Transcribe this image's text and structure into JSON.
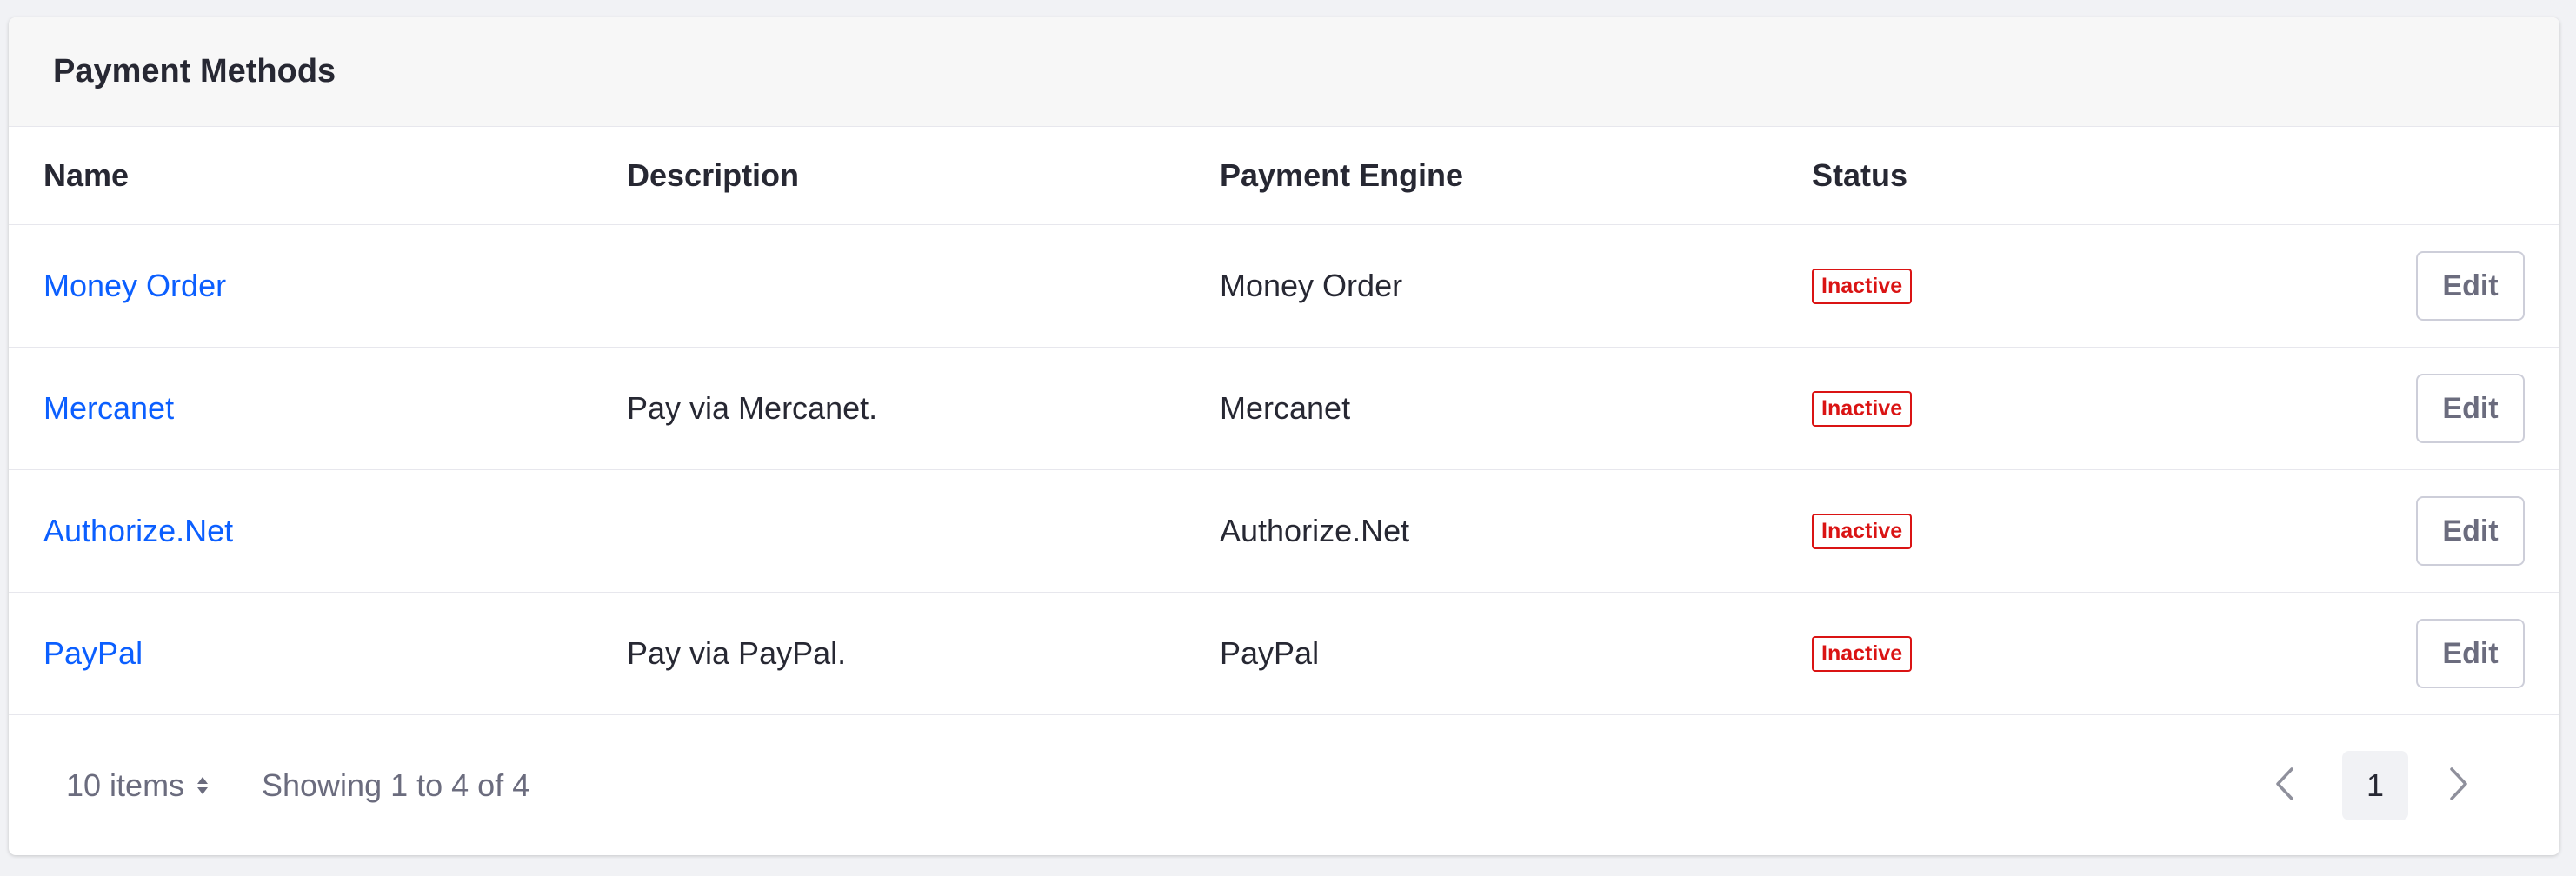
{
  "card": {
    "title": "Payment Methods"
  },
  "table": {
    "columns": {
      "name": "Name",
      "description": "Description",
      "engine": "Payment Engine",
      "status": "Status"
    },
    "rows": [
      {
        "name": "Money Order",
        "description": "",
        "engine": "Money Order",
        "status": "Inactive",
        "action": "Edit"
      },
      {
        "name": "Mercanet",
        "description": "Pay via Mercanet.",
        "engine": "Mercanet",
        "status": "Inactive",
        "action": "Edit"
      },
      {
        "name": "Authorize.Net",
        "description": "",
        "engine": "Authorize.Net",
        "status": "Inactive",
        "action": "Edit"
      },
      {
        "name": "PayPal",
        "description": "Pay via PayPal.",
        "engine": "PayPal",
        "status": "Inactive",
        "action": "Edit"
      }
    ]
  },
  "footer": {
    "per_page": "10 items",
    "results": "Showing 1 to 4 of 4",
    "current_page": "1"
  },
  "colors": {
    "link": "#0b5fff",
    "status_inactive": "#da1414",
    "muted_text": "#6b6c7e",
    "border": "#e7e7ed"
  },
  "icons": {
    "per_page": "sort-updown-icon",
    "prev": "chevron-left-icon",
    "next": "chevron-right-icon"
  }
}
